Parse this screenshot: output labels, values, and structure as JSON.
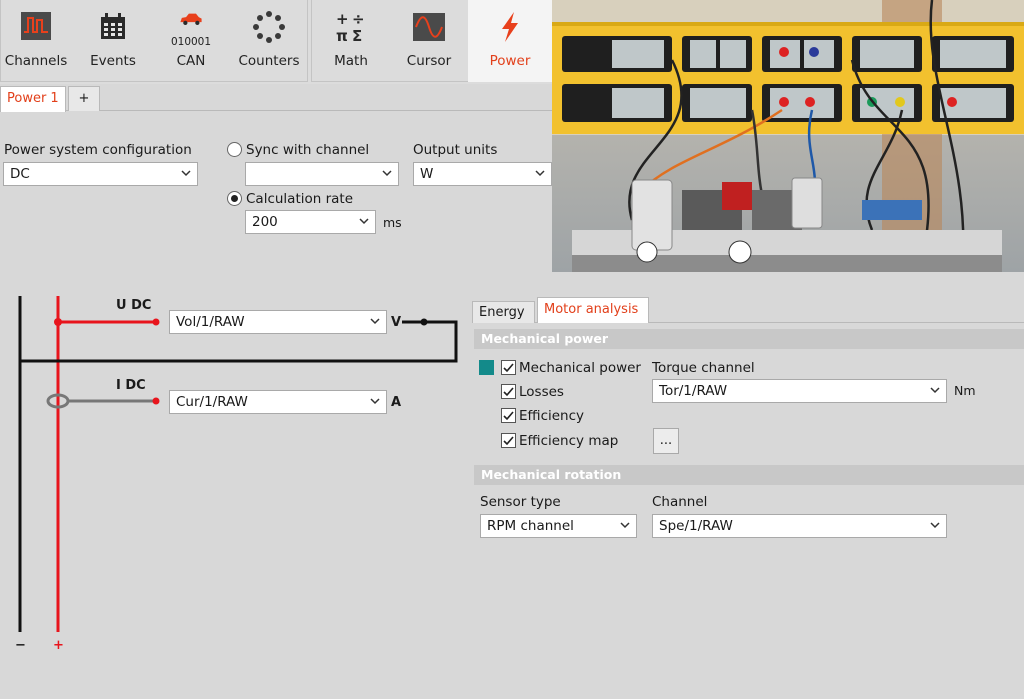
{
  "toolbar": {
    "left_group": [
      {
        "name": "channels",
        "label": "Channels",
        "icon": "channels-icon"
      },
      {
        "name": "events",
        "label": "Events",
        "icon": "calendar-icon"
      },
      {
        "name": "can",
        "label": "CAN",
        "icon": "car-icon",
        "code": "010001"
      },
      {
        "name": "counters",
        "label": "Counters",
        "icon": "counter-icon"
      }
    ],
    "right_group": [
      {
        "name": "math",
        "label": "Math",
        "icon": "math-icon"
      },
      {
        "name": "cursor",
        "label": "Cursor",
        "icon": "waveform-icon"
      },
      {
        "name": "power",
        "label": "Power",
        "icon": "lightning-icon",
        "active": true
      }
    ]
  },
  "tabs": {
    "active": "Power 1",
    "add": "+"
  },
  "config": {
    "power_system_label": "Power system configuration",
    "power_system_value": "DC",
    "sync_label": "Sync with channel",
    "sync_value": "",
    "output_units_label": "Output units",
    "output_units_value": "W",
    "calc_rate_label": "Calculation rate",
    "calc_rate_value": "200",
    "calc_rate_unit": "ms"
  },
  "circuit": {
    "u_label": "U DC",
    "u_channel": "Vol/1/RAW",
    "u_unit": "V",
    "i_label": "I DC",
    "i_channel": "Cur/1/RAW",
    "i_unit": "A",
    "minus": "−",
    "plus": "+"
  },
  "panel": {
    "tabs": [
      "Energy",
      "Motor analysis"
    ],
    "active_tab": "Motor analysis",
    "mech_power_header": "Mechanical power",
    "checkboxes": [
      {
        "label": "Mechanical power",
        "checked": true
      },
      {
        "label": "Losses",
        "checked": true
      },
      {
        "label": "Efficiency",
        "checked": true
      },
      {
        "label": "Efficiency map",
        "checked": true
      }
    ],
    "torque_label": "Torque channel",
    "torque_value": "Tor/1/RAW",
    "torque_unit": "Nm",
    "dots": "...",
    "mech_rotation_header": "Mechanical rotation",
    "sensor_type_label": "Sensor type",
    "sensor_type_value": "RPM channel",
    "channel_label": "Channel",
    "channel_value": "Spe/1/RAW"
  },
  "colors": {
    "accent": "#e2401b",
    "teal": "#138a8a",
    "wire_red": "#e8141c",
    "panel_yellow": "#f2c12e"
  }
}
